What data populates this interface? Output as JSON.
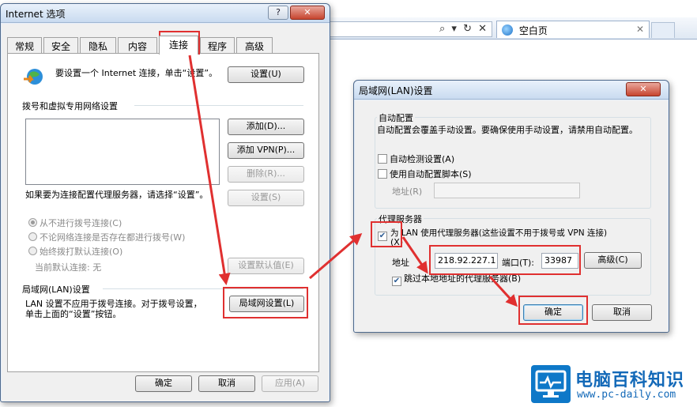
{
  "background_ie": {
    "nav_icons": "⌕ ▾ ↻ ✕",
    "tab_label": "空白页",
    "tab_close": "✕"
  },
  "internet_options": {
    "title": "Internet 选项",
    "help_button": "?",
    "close_button": "✕",
    "tabs": [
      "常规",
      "安全",
      "隐私",
      "内容",
      "连接",
      "程序",
      "高级"
    ],
    "setup_text": "要设置一个 Internet 连接，单击“设置”。",
    "setup_button": "设置(U)",
    "dialup_group": "拨号和虚拟专用网络设置",
    "add_button": "添加(D)...",
    "add_vpn_button": "添加 VPN(P)...",
    "delete_button": "删除(R)...",
    "settings_button": "设置(S)",
    "proxy_hint": "如果要为连接配置代理服务器，请选择“设置”。",
    "radio_never": "从不进行拨号连接(C)",
    "radio_no_network": "不论网络连接是否存在都进行拨号(W)",
    "radio_always": "始终拨打默认连接(O)",
    "current_default": "当前默认连接: 无",
    "set_default_button": "设置默认值(E)",
    "lan_group": "局域网(LAN)设置",
    "lan_text": "LAN 设置不应用于拨号连接。对于拨号设置，单击上面的“设置”按钮。",
    "lan_button": "局域网设置(L)",
    "ok_button": "确定",
    "cancel_button": "取消",
    "apply_button": "应用(A)"
  },
  "lan_settings": {
    "title": "局域网(LAN)设置",
    "close_button": "✕",
    "auto_config_group": "自动配置",
    "auto_config_text": "自动配置会覆盖手动设置。要确保使用手动设置，请禁用自动配置。",
    "auto_detect": "自动检测设置(A)",
    "use_script": "使用自动配置脚本(S)",
    "address_label": "地址(R)",
    "address_value": "",
    "proxy_group": "代理服务器",
    "use_proxy_line1": "为 LAN 使用代理服务器(这些设置不用于拨号或 VPN 连接)",
    "use_proxy_line2": "(X)",
    "proxy_address_label": "地址",
    "proxy_address_value": "218.92.227.1",
    "port_label": "端口(T):",
    "port_value": "33987",
    "advanced_button": "高级(C)",
    "bypass_local": "跳过本地地址的代理服务器(B)",
    "ok_button": "确定",
    "cancel_button": "取消",
    "check_mark": "✔"
  },
  "watermark": {
    "title": "电脑百科知识",
    "url": "www.pc-daily.com"
  },
  "colors": {
    "highlight": "#e03030",
    "window_frame": "#4f6a8d",
    "brand": "#1369b8"
  }
}
